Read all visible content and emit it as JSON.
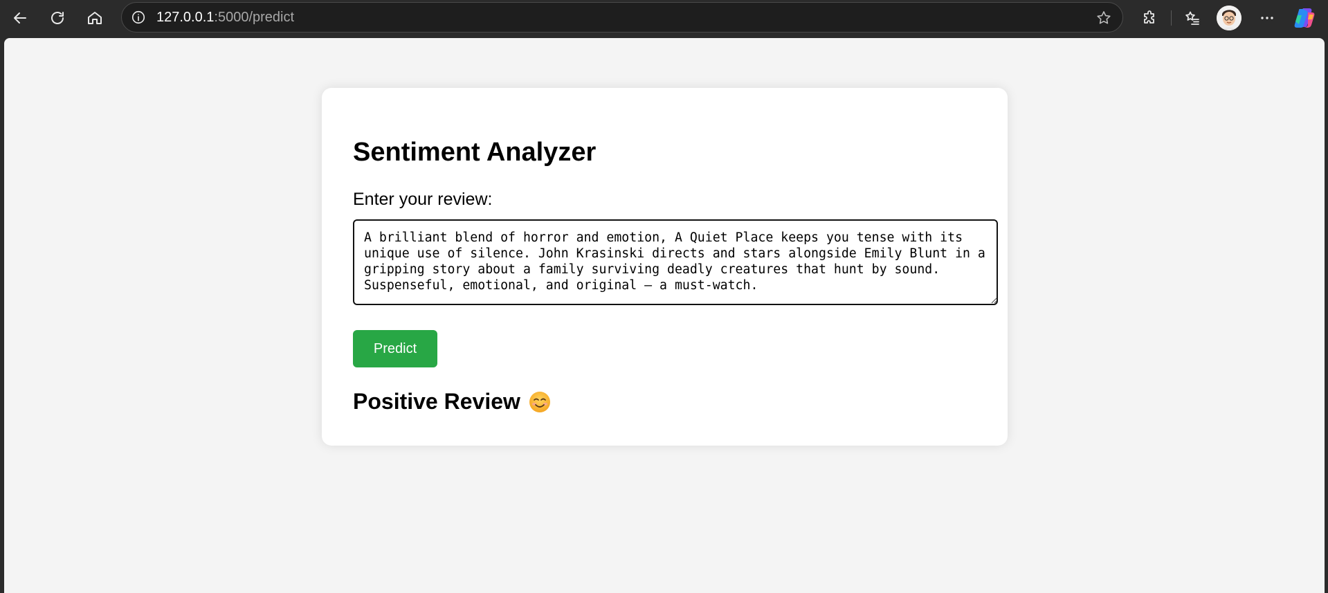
{
  "browser": {
    "url_host": "127.0.0.1",
    "url_rest": ":5000/predict"
  },
  "page": {
    "title": "Sentiment Analyzer",
    "review_label": "Enter your review:",
    "review_text": "A brilliant blend of horror and emotion, A Quiet Place keeps you tense with its unique use of silence. John Krasinski directs and stars alongside Emily Blunt in a gripping story about a family surviving deadly creatures that hunt by sound. Suspenseful, emotional, and original — a must-watch.",
    "predict_label": "Predict",
    "result_text": "Positive Review",
    "result_icon": "smiling-face-emoji"
  },
  "colors": {
    "predict_button": "#28a745",
    "page_background": "#f4f4f4",
    "card_background": "#ffffff"
  }
}
